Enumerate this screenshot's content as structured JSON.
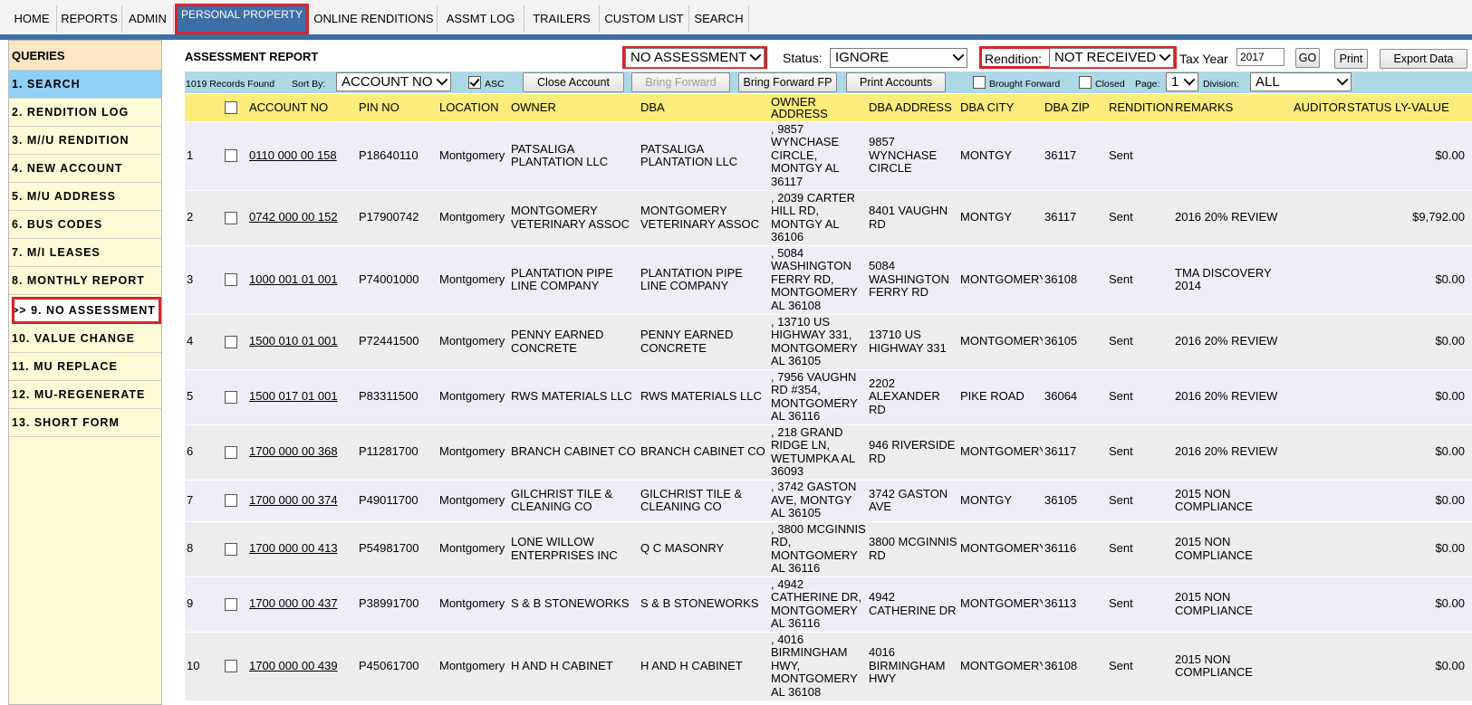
{
  "nav": {
    "tabs": [
      "HOME",
      "REPORTS",
      "ADMIN",
      "PERSONAL PROPERTY",
      "ONLINE RENDITIONS",
      "ASSMT LOG",
      "TRAILERS",
      "CUSTOM LIST",
      "SEARCH"
    ],
    "active_tab": "PERSONAL PROPERTY",
    "colors": {
      "accent": "#3d6ea6",
      "highlight": "#d8232a"
    }
  },
  "sidebar": {
    "title": "QUERIES",
    "items": [
      "1. SEARCH",
      "2. RENDITION LOG",
      "3. M//U RENDITION",
      "4. NEW ACCOUNT",
      "5. M/U ADDRESS",
      "6. BUS CODES",
      "7. M/I LEASES",
      "8. MONTHLY REPORT",
      ">> 9. NO ASSESSMENT",
      "10. VALUE CHANGE",
      "11. MU REPLACE",
      "12. MU-REGENERATE",
      "13. SHORT FORM"
    ]
  },
  "header": {
    "title": "ASSESSMENT REPORT",
    "report_select": "NO ASSESSMENT",
    "status_label": "Status:",
    "status_value": "IGNORE",
    "rendition_label": "Rendition:",
    "rendition_value": "NOT RECEIVED",
    "tax_year_label": "Tax Year",
    "tax_year_value": "2017",
    "go_label": "GO",
    "print_label": "Print",
    "export_label": "Export Data"
  },
  "toolbar": {
    "records_found": "1019 Records Found",
    "sort_by_label": "Sort By:",
    "sort_by_value": "ACCOUNT NO",
    "asc_label": "ASC",
    "asc_checked": true,
    "close_account": "Close Account",
    "bring_forward": "Bring Forward",
    "bring_forward_fp": "Bring Forward FP",
    "print_accounts": "Print Accounts",
    "brought_forward_label": "Brought Forward",
    "closed_label": "Closed",
    "page_label": "Page:",
    "page_value": "1",
    "division_label": "Division:",
    "division_value": "ALL"
  },
  "table": {
    "columns": [
      "",
      "",
      "ACCOUNT NO",
      "PIN NO",
      "LOCATION",
      "OWNER",
      "DBA",
      "OWNER ADDRESS",
      "DBA ADDRESS",
      "DBA CITY",
      "DBA ZIP",
      "RENDITION",
      "REMARKS",
      "AUDITOR",
      "STATUS",
      "LY-VALUE"
    ],
    "rows": [
      {
        "n": "1",
        "account": "0110 000 00 158",
        "pin": "P18640110",
        "location": "Montgomery",
        "owner": "PATSALIGA PLANTATION LLC",
        "dba": "PATSALIGA PLANTATION LLC",
        "owner_address": ", 9857 WYNCHASE CIRCLE, MONTGY AL 36117",
        "dba_address": "9857 WYNCHASE CIRCLE",
        "city": "MONTGY",
        "zip": "36117",
        "rendition": "Sent",
        "remarks": "",
        "auditor": "",
        "status": "",
        "ly_value": "$0.00"
      },
      {
        "n": "2",
        "account": "0742 000 00 152",
        "pin": "P17900742",
        "location": "Montgomery",
        "owner": "MONTGOMERY VETERINARY ASSOC",
        "dba": "MONTGOMERY VETERINARY ASSOC",
        "owner_address": ", 2039 CARTER HILL RD, MONTGY AL 36106",
        "dba_address": "8401 VAUGHN RD",
        "city": "MONTGY",
        "zip": "36117",
        "rendition": "Sent",
        "remarks": "2016 20% REVIEW",
        "auditor": "",
        "status": "",
        "ly_value": "$9,792.00"
      },
      {
        "n": "3",
        "account": "1000 001 01 001",
        "pin": "P74001000",
        "location": "Montgomery",
        "owner": "PLANTATION PIPE LINE COMPANY",
        "dba": "PLANTATION PIPE LINE COMPANY",
        "owner_address": ", 5084 WASHINGTON FERRY RD, MONTGOMERY AL 36108",
        "dba_address": "5084 WASHINGTON FERRY RD",
        "city": "MONTGOMERY",
        "zip": "36108",
        "rendition": "Sent",
        "remarks": "TMA DISCOVERY 2014",
        "auditor": "",
        "status": "",
        "ly_value": "$0.00"
      },
      {
        "n": "4",
        "account": "1500 010 01 001",
        "pin": "P72441500",
        "location": "Montgomery",
        "owner": "PENNY EARNED CONCRETE",
        "dba": "PENNY EARNED CONCRETE",
        "owner_address": ", 13710 US HIGHWAY 331, MONTGOMERY AL 36105",
        "dba_address": "13710 US HIGHWAY 331",
        "city": "MONTGOMERY",
        "zip": "36105",
        "rendition": "Sent",
        "remarks": "2016 20% REVIEW",
        "auditor": "",
        "status": "",
        "ly_value": "$0.00"
      },
      {
        "n": "5",
        "account": "1500 017 01 001",
        "pin": "P83311500",
        "location": "Montgomery",
        "owner": "RWS MATERIALS LLC",
        "dba": "RWS MATERIALS LLC",
        "owner_address": ", 7956 VAUGHN RD #354, MONTGOMERY AL 36116",
        "dba_address": "2202 ALEXANDER RD",
        "city": "PIKE ROAD",
        "zip": "36064",
        "rendition": "Sent",
        "remarks": "2016 20% REVIEW",
        "auditor": "",
        "status": "",
        "ly_value": "$0.00"
      },
      {
        "n": "6",
        "account": "1700 000 00 368",
        "pin": "P11281700",
        "location": "Montgomery",
        "owner": "BRANCH CABINET CO",
        "dba": "BRANCH CABINET CO",
        "owner_address": ", 218 GRAND RIDGE LN, WETUMPKA AL 36093",
        "dba_address": "946 RIVERSIDE RD",
        "city": "MONTGOMERY",
        "zip": "36117",
        "rendition": "Sent",
        "remarks": "2016 20% REVIEW",
        "auditor": "",
        "status": "",
        "ly_value": "$0.00"
      },
      {
        "n": "7",
        "account": "1700 000 00 374",
        "pin": "P49011700",
        "location": "Montgomery",
        "owner": "GILCHRIST TILE & CLEANING CO",
        "dba": "GILCHRIST TILE & CLEANING CO",
        "owner_address": ", 3742 GASTON AVE, MONTGY AL 36105",
        "dba_address": "3742 GASTON AVE",
        "city": "MONTGY",
        "zip": "36105",
        "rendition": "Sent",
        "remarks": "2015 NON COMPLIANCE",
        "auditor": "",
        "status": "",
        "ly_value": "$0.00"
      },
      {
        "n": "8",
        "account": "1700 000 00 413",
        "pin": "P54981700",
        "location": "Montgomery",
        "owner": "LONE WILLOW ENTERPRISES INC",
        "dba": "Q C MASONRY",
        "owner_address": ", 3800 MCGINNIS RD, MONTGOMERY AL 36116",
        "dba_address": "3800 MCGINNIS RD",
        "city": "MONTGOMERY",
        "zip": "36116",
        "rendition": "Sent",
        "remarks": "2015 NON COMPLIANCE",
        "auditor": "",
        "status": "",
        "ly_value": "$0.00"
      },
      {
        "n": "9",
        "account": "1700 000 00 437",
        "pin": "P38991700",
        "location": "Montgomery",
        "owner": "S & B STONEWORKS",
        "dba": "S & B STONEWORKS",
        "owner_address": ", 4942 CATHERINE DR, MONTGOMERY AL 36116",
        "dba_address": "4942 CATHERINE DR",
        "city": "MONTGOMERY",
        "zip": "36113",
        "rendition": "Sent",
        "remarks": "2015 NON COMPLIANCE",
        "auditor": "",
        "status": "",
        "ly_value": "$0.00"
      },
      {
        "n": "10",
        "account": "1700 000 00 439",
        "pin": "P45061700",
        "location": "Montgomery",
        "owner": "H AND H CABINET",
        "dba": "H AND H CABINET",
        "owner_address": ", 4016 BIRMINGHAM HWY, MONTGOMERY AL 36108",
        "dba_address": "4016 BIRMINGHAM HWY",
        "city": "MONTGOMERY",
        "zip": "36108",
        "rendition": "Sent",
        "remarks": "2015 NON COMPLIANCE",
        "auditor": "",
        "status": "",
        "ly_value": "$0.00"
      }
    ]
  }
}
